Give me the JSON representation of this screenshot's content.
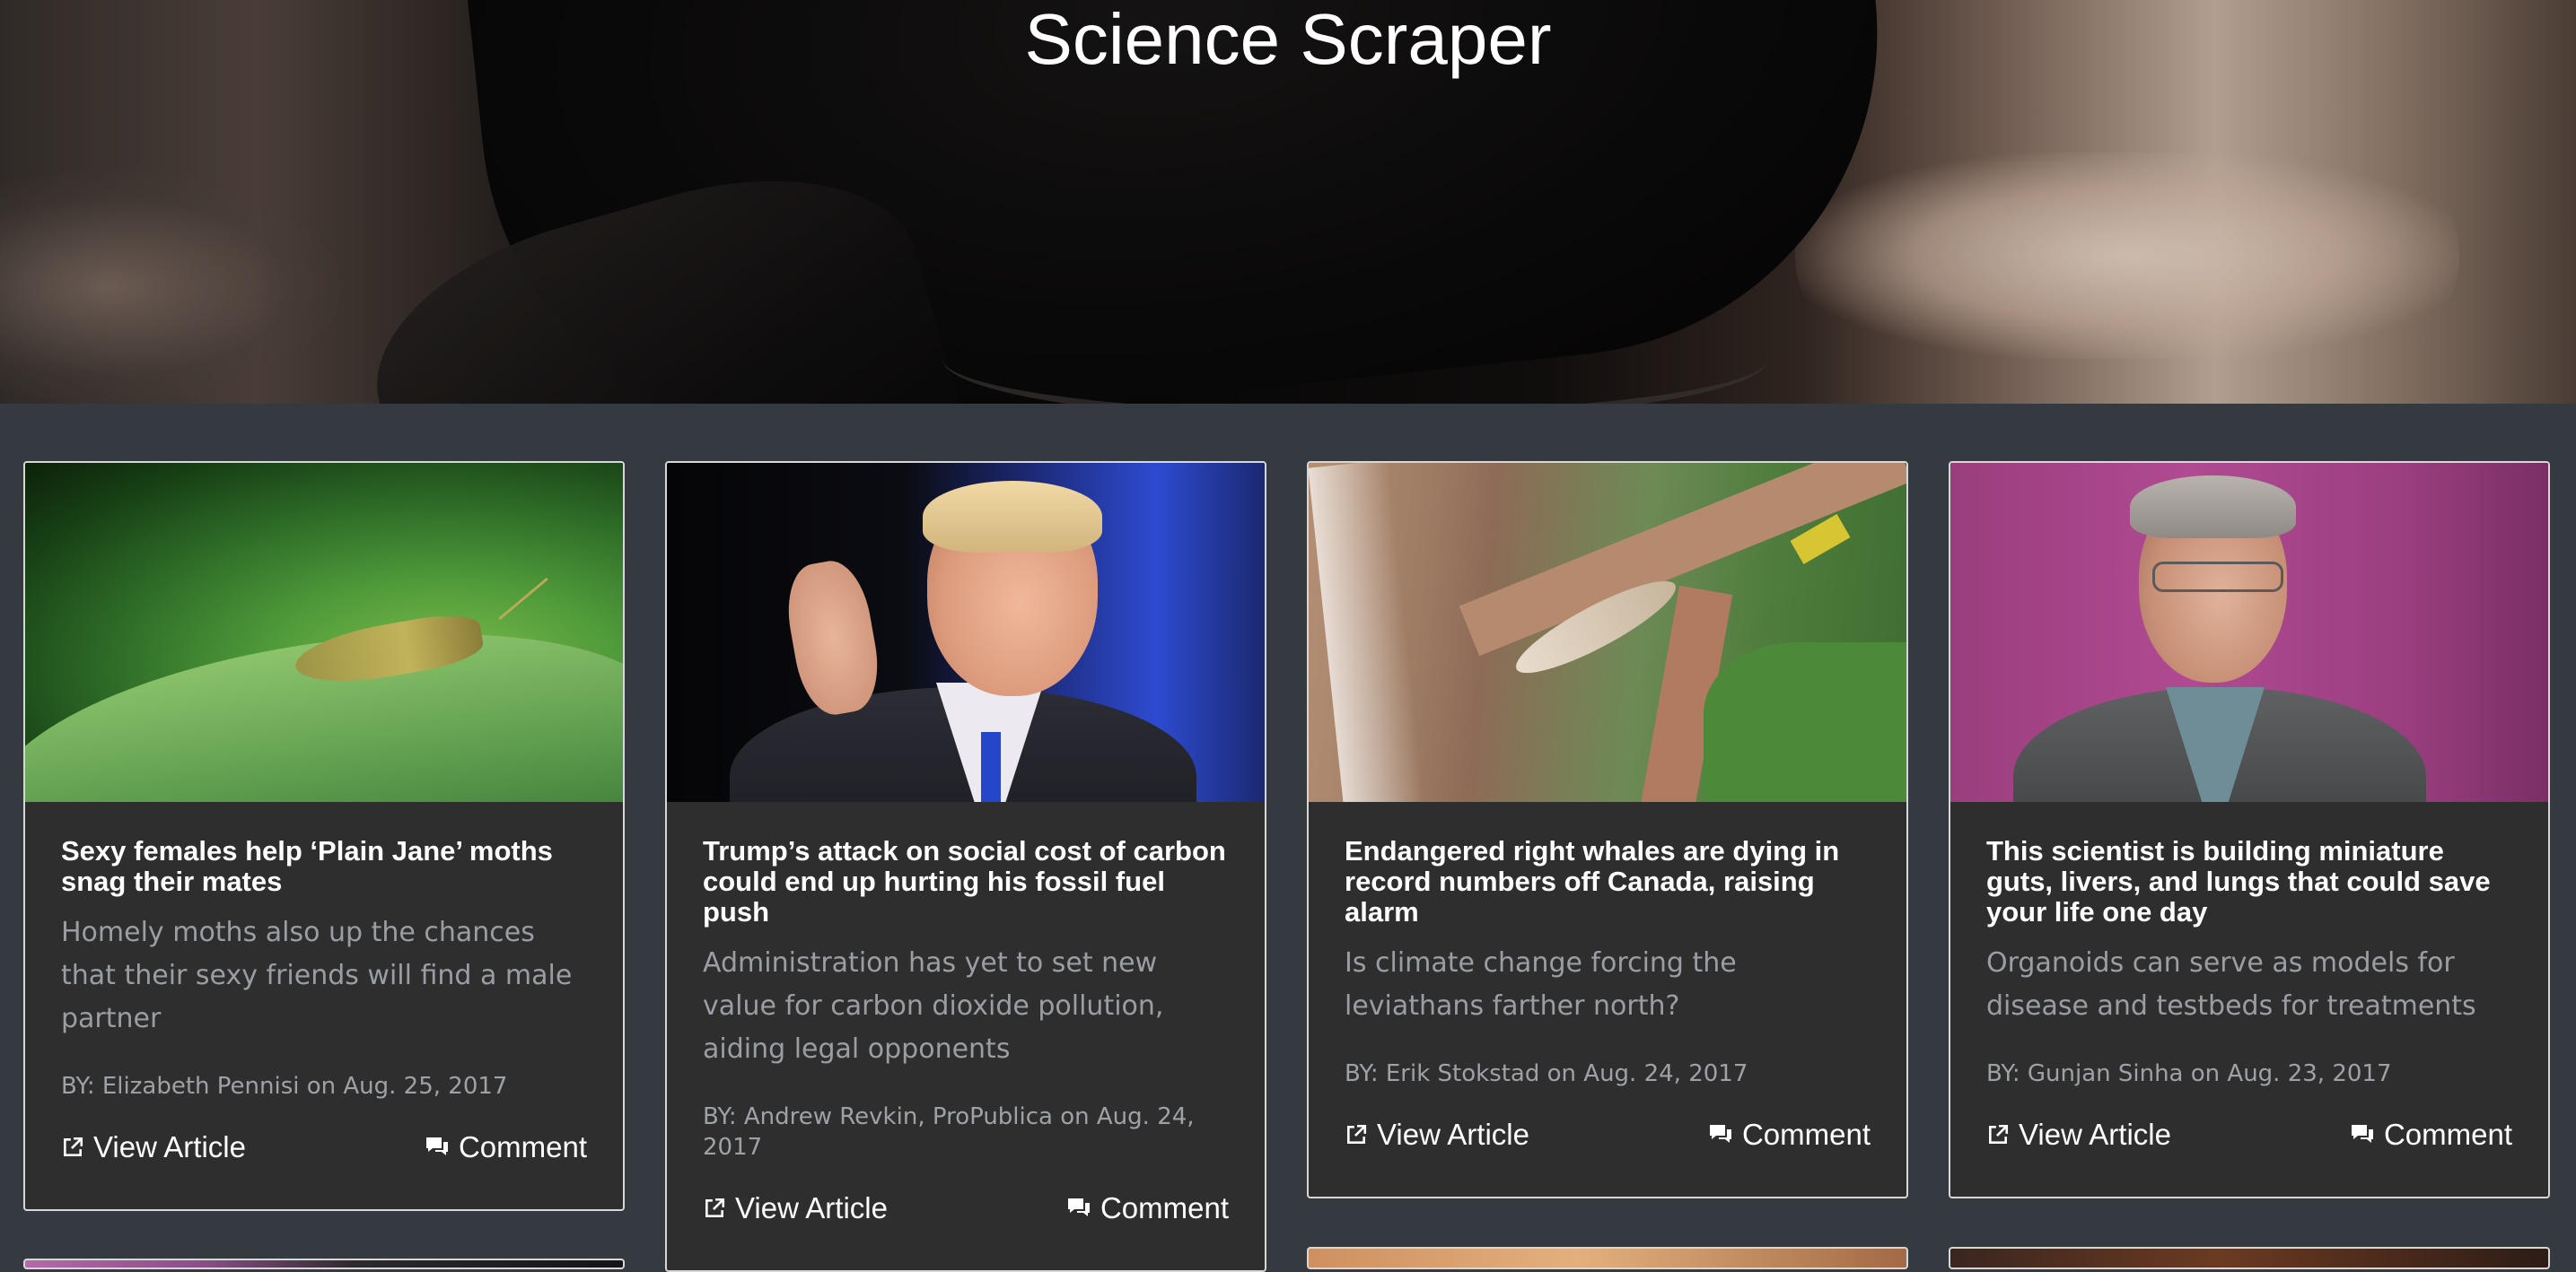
{
  "header": {
    "title": "Science Scraper"
  },
  "cards": [
    {
      "title": "Sexy females help ‘Plain Jane’ moths snag their mates",
      "description": "Homely moths also up the chances that their sexy friends will find a male partner",
      "byline": "BY: Elizabeth Pennisi on Aug. 25, 2017",
      "view_label": "View Article",
      "comment_label": "Comment",
      "image": "moth-on-leaf"
    },
    {
      "title": "Trump’s attack on social cost of carbon could end up hurting his fossil fuel push",
      "description": "Administration has yet to set new value for carbon dioxide pollution, aiding legal opponents",
      "byline": "BY: Andrew Revkin, ProPublica on Aug. 24, 2017",
      "view_label": "View Article",
      "comment_label": "Comment",
      "image": "speaker-at-podium"
    },
    {
      "title": "Endangered right whales are dying in record numbers off Canada, raising alarm",
      "description": "Is climate change forcing the leviathans farther north?",
      "byline": "BY: Erik Stokstad on Aug. 24, 2017",
      "view_label": "View Article",
      "comment_label": "Comment",
      "image": "whale-on-shore-aerial"
    },
    {
      "title": "This scientist is building miniature guts, livers, and lungs that could save your life one day",
      "description": "Organoids can serve as models for disease and testbeds for treatments",
      "byline": "BY: Gunjan Sinha on Aug. 23, 2017",
      "view_label": "View Article",
      "comment_label": "Comment",
      "image": "scientist-portrait"
    }
  ],
  "icons": {
    "view": "external-link-icon",
    "comment": "comment-icon"
  },
  "colors": {
    "background": "#343a40",
    "card_background": "#2e2e2f",
    "card_border": "#d7d7d7",
    "title_text": "#ffffff",
    "muted_text": "#9a9ea3"
  }
}
